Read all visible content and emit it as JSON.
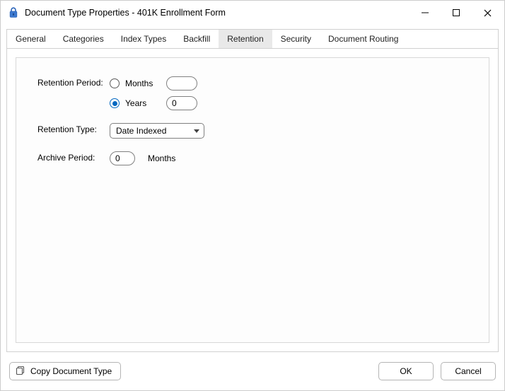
{
  "window": {
    "title": "Document Type Properties  - 401K Enrollment Form"
  },
  "tabs": {
    "items": [
      {
        "label": "General"
      },
      {
        "label": "Categories"
      },
      {
        "label": "Index Types"
      },
      {
        "label": "Backfill"
      },
      {
        "label": "Retention"
      },
      {
        "label": "Security"
      },
      {
        "label": "Document Routing"
      }
    ],
    "active_index": 4
  },
  "retention": {
    "period_label": "Retention Period:",
    "months_label": "Months",
    "years_label": "Years",
    "unit_selected": "years",
    "months_value": "",
    "years_value": "0",
    "type_label": "Retention Type:",
    "type_value": "Date Indexed",
    "archive_label": "Archive Period:",
    "archive_value": "0",
    "archive_unit": "Months"
  },
  "footer": {
    "copy_label": "Copy Document Type",
    "ok_label": "OK",
    "cancel_label": "Cancel"
  }
}
